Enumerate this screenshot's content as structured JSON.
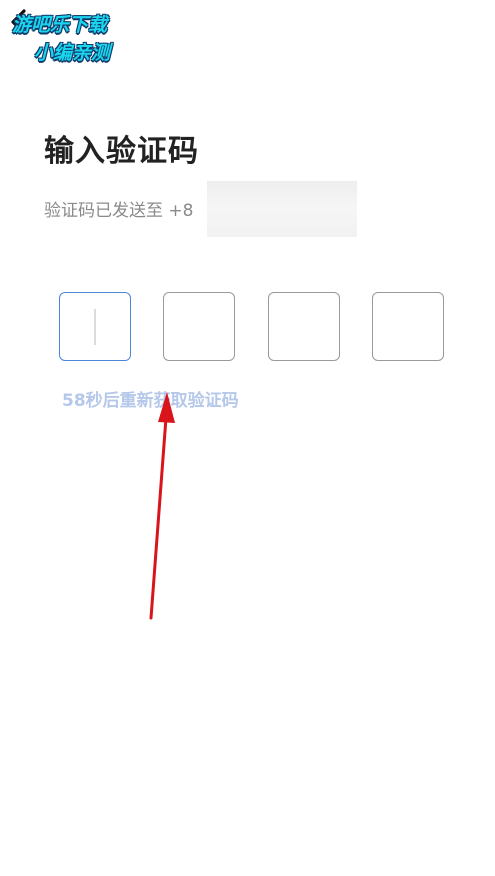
{
  "header": {
    "back_icon": "chevron-left-icon",
    "watermark_line1": "游吧乐下载",
    "watermark_line2": "小编亲测"
  },
  "main": {
    "title": "输入验证码",
    "subtitle_prefix": "验证码已发送至 +8",
    "code_boxes": [
      "",
      "",
      "",
      ""
    ],
    "resend_text": "58秒后重新获取验证码"
  },
  "colors": {
    "active_border": "#4a86d8",
    "resend_text": "#b5c8ea",
    "annotation_arrow": "#d9141b"
  }
}
